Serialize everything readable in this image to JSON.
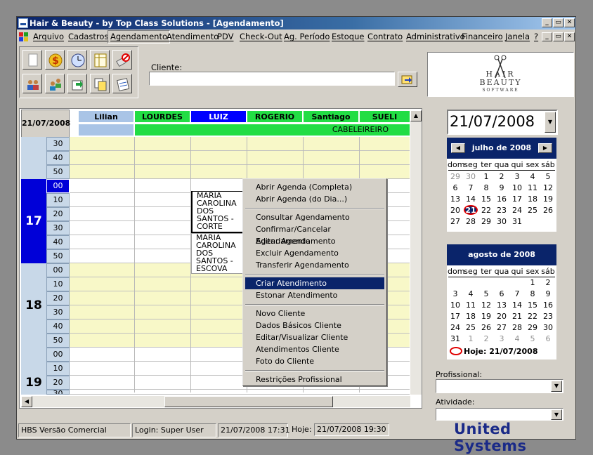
{
  "window": {
    "title": "Hair & Beauty - by Top Class Solutions - [Agendamento]",
    "controls": [
      "_",
      "▭",
      "✕"
    ]
  },
  "menu": [
    "Arquivo",
    "Cadastros",
    "Agendamento",
    "Atendimento",
    "PDV",
    "Check-Out",
    "Ag. Período",
    "Estoque",
    "Contrato",
    "Administrativo",
    "Financeiro",
    "Janela",
    "?"
  ],
  "cliente": {
    "label": "Cliente:",
    "value": ""
  },
  "logo": {
    "top": "HAIR",
    "middle": "BEAUTY",
    "bottom": "SOFTWARE"
  },
  "schedule": {
    "date": "21/07/2008",
    "professionals": [
      "Lilian",
      "LOURDES",
      "LUIZ",
      "ROGERIO",
      "Santiago",
      "SUELI"
    ],
    "category": "CABELEIREIRO",
    "hours": [
      "17",
      "18",
      "19"
    ],
    "minutes_prev": [
      "30",
      "40",
      "50"
    ],
    "minutes": [
      "00",
      "10",
      "20",
      "30",
      "40",
      "50"
    ],
    "minutes_19": [
      "00",
      "10",
      "20",
      "30"
    ],
    "appointments": [
      "MARIA CAROLINA DOS SANTOS - CORTE",
      "MARIA CAROLINA DOS SANTOS - ESCOVA"
    ]
  },
  "context_menu": {
    "group1": [
      "Abrir Agenda (Completa)",
      "Abrir Agenda (do Dia...)"
    ],
    "group2": [
      "Consultar Agendamento",
      "Confirmar/Cancelar Agendamento",
      "Editar Agendamento",
      "Excluir Agendamento",
      "Transferir Agendamento"
    ],
    "group3": [
      "Criar Atendimento",
      "Estonar Atendimento"
    ],
    "group4": [
      "Novo Cliente",
      "Dados Básicos Cliente",
      "Editar/Visualizar Cliente",
      "Atendimentos Cliente",
      "Foto do Cliente"
    ],
    "group5": [
      "Restrições Profissional"
    ],
    "highlighted": "Criar Atendimento"
  },
  "date_picker": {
    "value": "21/07/2008"
  },
  "calendar_july": {
    "title": "julho de 2008",
    "dow": [
      "dom",
      "seg",
      "ter",
      "qua",
      "qui",
      "sex",
      "sáb"
    ],
    "weeks": [
      [
        "29",
        "30",
        "1",
        "2",
        "3",
        "4",
        "5"
      ],
      [
        "6",
        "7",
        "8",
        "9",
        "10",
        "11",
        "12"
      ],
      [
        "13",
        "14",
        "15",
        "16",
        "17",
        "18",
        "19"
      ],
      [
        "20",
        "21",
        "22",
        "23",
        "24",
        "25",
        "26"
      ],
      [
        "27",
        "28",
        "29",
        "30",
        "31",
        "",
        ""
      ]
    ],
    "today": "21"
  },
  "calendar_august": {
    "title": "agosto de 2008",
    "dow": [
      "dom",
      "seg",
      "ter",
      "qua",
      "qui",
      "sex",
      "sáb"
    ],
    "weeks": [
      [
        "",
        "",
        "",
        "",
        "",
        "1",
        "2"
      ],
      [
        "3",
        "4",
        "5",
        "6",
        "7",
        "8",
        "9"
      ],
      [
        "10",
        "11",
        "12",
        "13",
        "14",
        "15",
        "16"
      ],
      [
        "17",
        "18",
        "19",
        "20",
        "21",
        "22",
        "23"
      ],
      [
        "24",
        "25",
        "26",
        "27",
        "28",
        "29",
        "30"
      ],
      [
        "31",
        "1",
        "2",
        "3",
        "4",
        "5",
        "6"
      ]
    ],
    "today_label": "Hoje: 21/07/2008"
  },
  "filters": {
    "profissional_label": "Profissional:",
    "atividade_label": "Atividade:"
  },
  "status": {
    "version": "HBS Versão Comercial",
    "login_label": "Login:",
    "login_user": "Super User",
    "login_time": "21/07/2008 17:31",
    "hoje_label": "Hoje:",
    "hoje_time": "21/07/2008 19:30",
    "brand": "United Systems"
  },
  "colors": {
    "title_bar": "#0a246a",
    "selected_hour": "#0000d8",
    "header_green": "#22dd44",
    "header_blue_selected": "#0000ff",
    "lilian_header": "#a9c4e6",
    "row_yellow": "#f8f8c8",
    "menu_highlight": "#0a246a",
    "brand": "#1a2a88"
  }
}
